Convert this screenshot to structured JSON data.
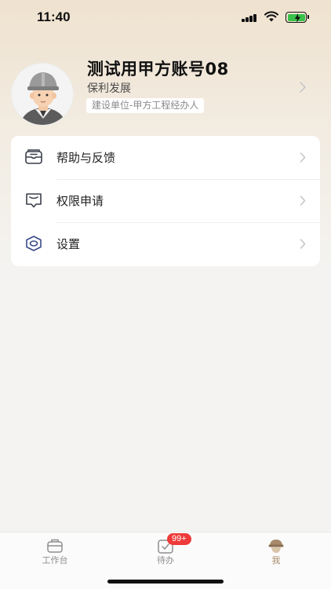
{
  "status_bar": {
    "time": "11:40",
    "battery_color": "#38c24a"
  },
  "profile": {
    "name": "测试用甲方账号08",
    "company": "保利发展",
    "role": "建设单位-甲方工程经办人",
    "avatar_icon": "worker-avatar"
  },
  "menu": {
    "items": [
      {
        "label": "帮助与反馈",
        "icon": "help-inbox-icon"
      },
      {
        "label": "权限申请",
        "icon": "permission-message-icon"
      },
      {
        "label": "设置",
        "icon": "settings-hexagon-icon"
      }
    ]
  },
  "tab_bar": {
    "tabs": [
      {
        "label": "工作台",
        "icon": "workbench-briefcase-icon"
      },
      {
        "label": "待办",
        "icon": "todo-check-icon",
        "badge": "99+"
      },
      {
        "label": "我",
        "icon": "me-helmet-icon",
        "active": true
      }
    ],
    "active_color": "#a68a6a",
    "badge_color": "#ee3a3a"
  }
}
